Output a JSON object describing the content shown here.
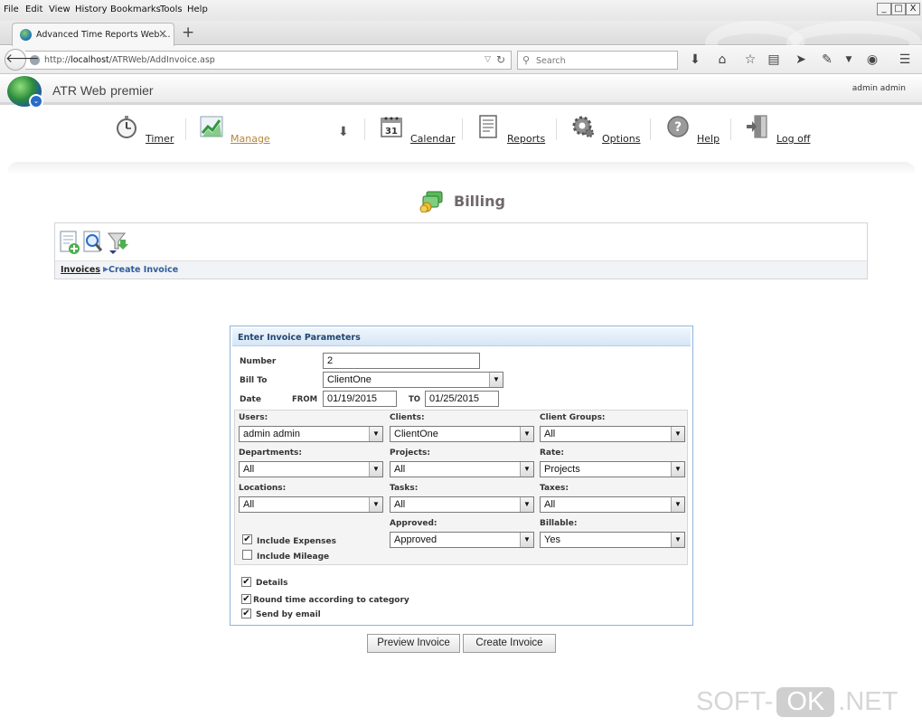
{
  "browser": {
    "menu": [
      "File",
      "Edit",
      "View",
      "History",
      "Bookmarks",
      "Tools",
      "Help"
    ],
    "window_buttons": [
      "_",
      "□",
      "X"
    ],
    "tab_title": "Advanced Time Reports Web ...",
    "tab_close": "×",
    "new_tab": "+",
    "url_prefix": "http://",
    "url_host": "localhost",
    "url_path": "/ATRWeb/AddInvoice.asp",
    "search_placeholder": "Search"
  },
  "app": {
    "title": "ATR Web",
    "title_suffix": "premier",
    "user": "admin admin"
  },
  "nav": {
    "timer": "Timer",
    "manage": "Manage",
    "calendar": "Calendar",
    "calendar_day": "31",
    "reports": "Reports",
    "options": "Options",
    "help": "Help",
    "logoff": "Log off"
  },
  "page": {
    "title": "Billing",
    "breadcrumb_invoices": "Invoices",
    "breadcrumb_current": "Create Invoice"
  },
  "form": {
    "header": "Enter Invoice Parameters",
    "number_label": "Number",
    "number_value": "2",
    "billto_label": "Bill To",
    "billto_value": "ClientOne",
    "date_label": "Date",
    "from_label": "FROM",
    "from_value": "01/19/2015",
    "to_label": "TO",
    "to_value": "01/25/2015",
    "users_label": "Users:",
    "users_value": "admin admin",
    "clients_label": "Clients:",
    "clients_value": "ClientOne",
    "clientgroups_label": "Client Groups:",
    "clientgroups_value": "All",
    "departments_label": "Departments:",
    "departments_value": "All",
    "projects_label": "Projects:",
    "projects_value": "All",
    "rate_label": "Rate:",
    "rate_value": "Projects",
    "locations_label": "Locations:",
    "locations_value": "All",
    "tasks_label": "Tasks:",
    "tasks_value": "All",
    "taxes_label": "Taxes:",
    "taxes_value": "All",
    "approved_label": "Approved:",
    "approved_value": "Approved",
    "billable_label": "Billable:",
    "billable_value": "Yes",
    "include_expenses": "Include Expenses",
    "include_expenses_checked": true,
    "include_mileage": "Include Mileage",
    "include_mileage_checked": false,
    "details": "Details",
    "details_checked": true,
    "round_time": "Round time according to category",
    "round_time_checked": true,
    "send_email": "Send by email",
    "send_email_checked": true
  },
  "buttons": {
    "preview": "Preview Invoice",
    "create": "Create Invoice"
  },
  "watermark": {
    "left": "SOFT-",
    "middle": "OK",
    "right": ".NET"
  }
}
